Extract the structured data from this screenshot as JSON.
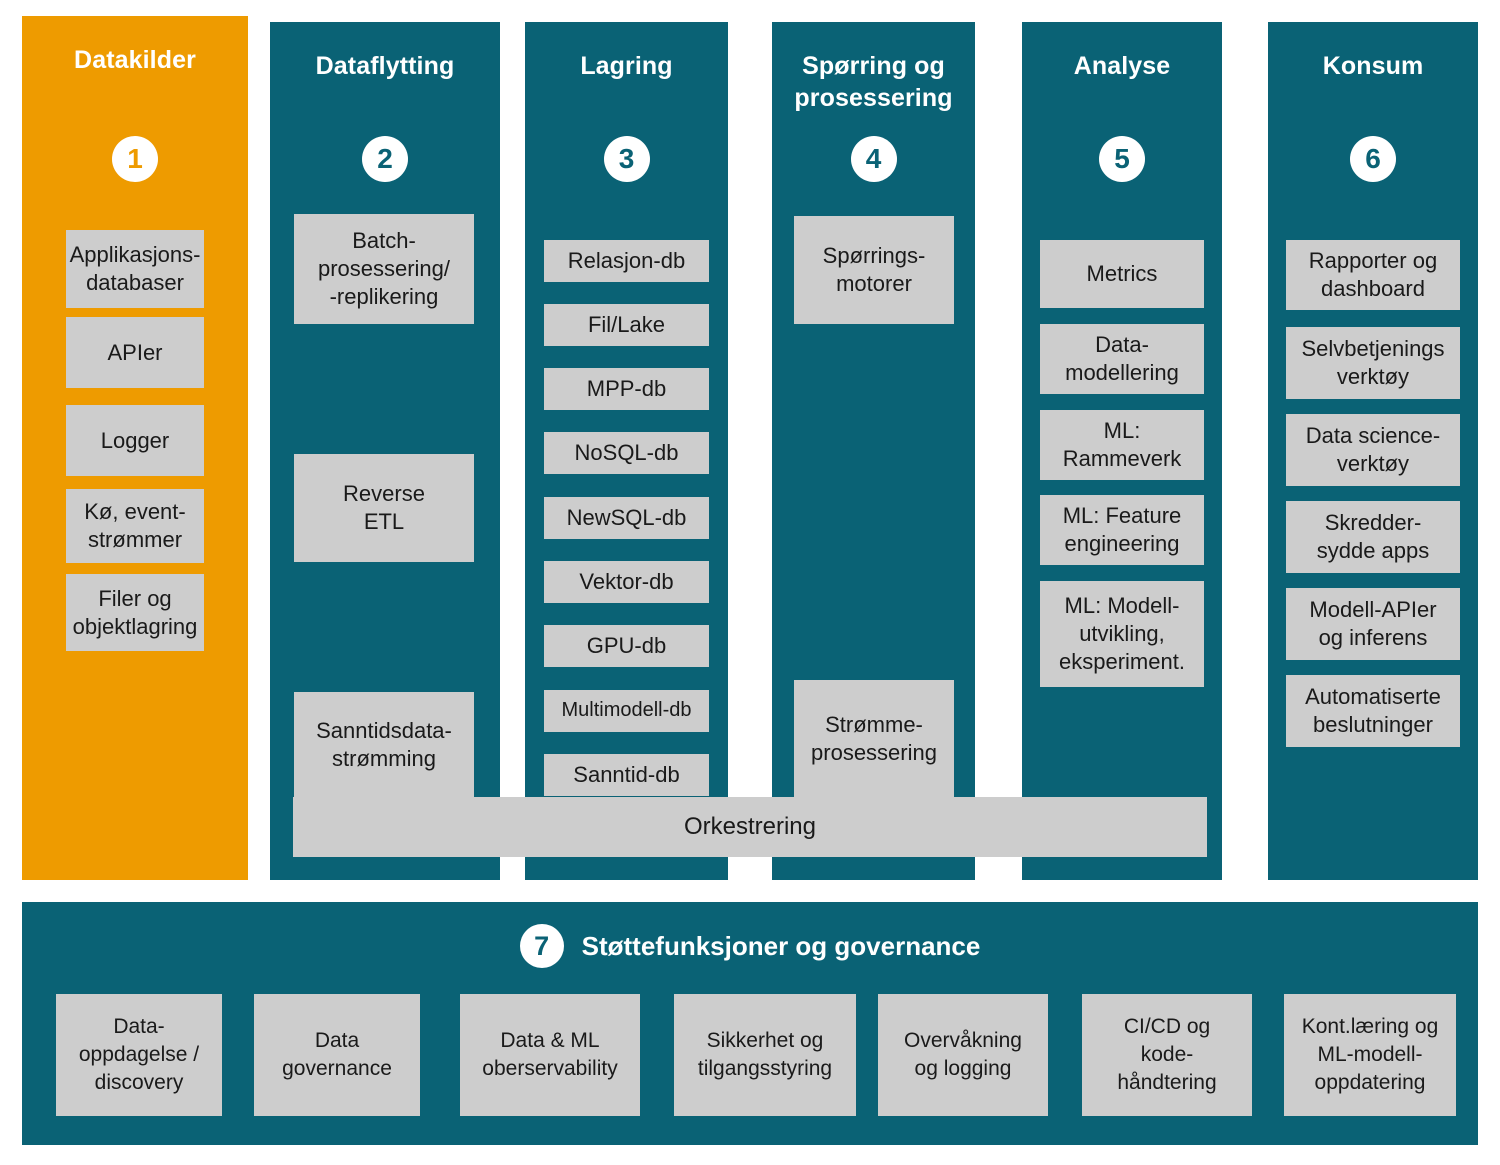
{
  "colors": {
    "accent_orange": "#ee9b00",
    "teal": "#0a6275",
    "tile_gray": "#cdcdcd",
    "text_dark": "#1a1a1a",
    "text_light": "#ffffff"
  },
  "columns": [
    {
      "number": "1",
      "title": "Datakilder",
      "accent": true,
      "items": [
        {
          "label": "Applikasjons-\ndatabaser"
        },
        {
          "label": "APIer"
        },
        {
          "label": "Logger"
        },
        {
          "label": "Kø, event-\nstrømmer"
        },
        {
          "label": "Filer og\nobjektlagring"
        }
      ]
    },
    {
      "number": "2",
      "title": "Dataflytting",
      "accent": false,
      "items": [
        {
          "label": "Batch-\nprosessering/\n-replikering"
        },
        {
          "label": "Reverse\nETL"
        },
        {
          "label": "Sanntidsdata-\nstrømming"
        }
      ]
    },
    {
      "number": "3",
      "title": "Lagring",
      "accent": false,
      "items": [
        {
          "label": "Relasjon-db"
        },
        {
          "label": "Fil/Lake"
        },
        {
          "label": "MPP-db"
        },
        {
          "label": "NoSQL-db"
        },
        {
          "label": "NewSQL-db"
        },
        {
          "label": "Vektor-db"
        },
        {
          "label": "GPU-db"
        },
        {
          "label": "Multimodell-db"
        },
        {
          "label": "Sanntid-db"
        }
      ]
    },
    {
      "number": "4",
      "title": "Spørring og\nprosessering",
      "accent": false,
      "items": [
        {
          "label": "Spørrings-\nmotorer"
        },
        {
          "label": "Strømme-\nprosessering"
        }
      ]
    },
    {
      "number": "5",
      "title": "Analyse",
      "accent": false,
      "items": [
        {
          "label": "Metrics"
        },
        {
          "label": "Data-\nmodellering"
        },
        {
          "label": "ML:\nRammeverk"
        },
        {
          "label": "ML: Feature\nengineering"
        },
        {
          "label": "ML: Modell-\nutvikling,\neksperiment."
        }
      ]
    },
    {
      "number": "6",
      "title": "Konsum",
      "accent": false,
      "items": [
        {
          "label": "Rapporter og\ndashboard"
        },
        {
          "label": "Selvbetjenings\nverktøy"
        },
        {
          "label": "Data science-\nverktøy"
        },
        {
          "label": "Skredder-\nsydde apps"
        },
        {
          "label": "Modell-APIer\nog inferens"
        },
        {
          "label": "Automatiserte\nbeslutninger"
        }
      ]
    }
  ],
  "orchestration": {
    "label": "Orkestrering"
  },
  "support": {
    "number": "7",
    "title": "Støttefunksjoner og governance",
    "items": [
      {
        "label": "Data-\noppdagelse /\ndiscovery"
      },
      {
        "label": "Data\ngovernance"
      },
      {
        "label": "Data & ML\noberservability"
      },
      {
        "label": "Sikkerhet og\ntilgangsstyring"
      },
      {
        "label": "Overvåkning\nog logging"
      },
      {
        "label": "CI/CD og\nkode-\nhåndtering"
      },
      {
        "label": "Kont.læring og\nML-modell-\noppdatering"
      }
    ]
  }
}
